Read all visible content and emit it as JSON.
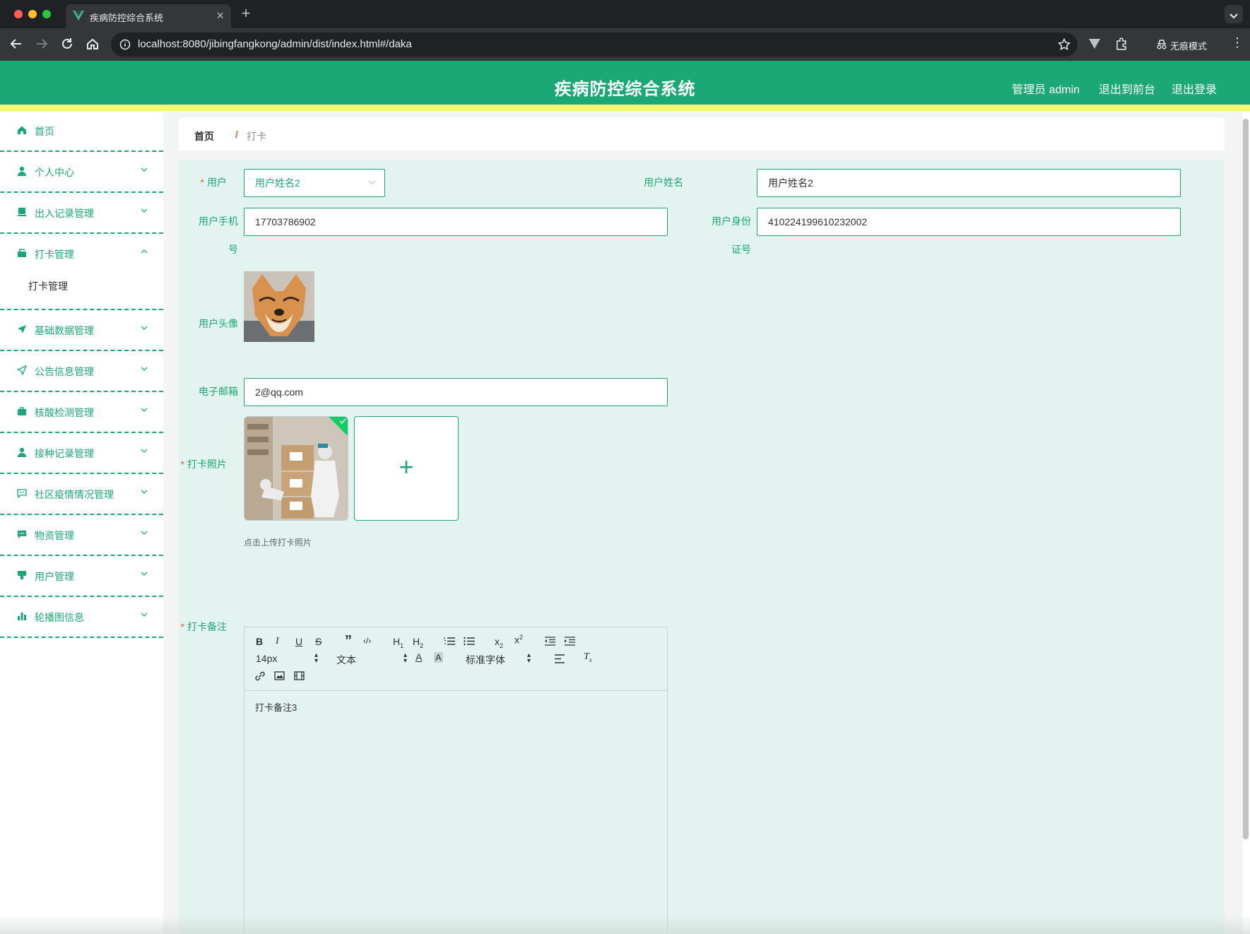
{
  "browser": {
    "tab_title": "疾病防控综合系统",
    "url": "localhost:8080/jibingfangkong/admin/dist/index.html#/daka",
    "incognito_label": "无痕模式"
  },
  "header": {
    "title": "疾病防控综合系统",
    "user_label": "管理员 admin",
    "to_front": "退出到前台",
    "logout": "退出登录"
  },
  "sidebar": {
    "items": [
      {
        "label": "首页",
        "icon": "home-icon"
      },
      {
        "label": "个人中心",
        "icon": "user-icon"
      },
      {
        "label": "出入记录管理",
        "icon": "record-icon"
      },
      {
        "label": "打卡管理",
        "icon": "punch-icon",
        "expanded": true
      },
      {
        "label": "基础数据管理",
        "icon": "send-icon"
      },
      {
        "label": "公告信息管理",
        "icon": "notice-icon"
      },
      {
        "label": "核酸检测管理",
        "icon": "briefcase-icon"
      },
      {
        "label": "接种记录管理",
        "icon": "user-icon"
      },
      {
        "label": "社区疫情情况管理",
        "icon": "chat-icon"
      },
      {
        "label": "物资管理",
        "icon": "message-icon"
      },
      {
        "label": "用户管理",
        "icon": "stamp-icon"
      },
      {
        "label": "轮播图信息",
        "icon": "chart-icon"
      }
    ],
    "submenu_label": "打卡管理"
  },
  "breadcrumb": {
    "home": "首页",
    "separator": "/",
    "current": "打卡"
  },
  "form": {
    "user_label": "用户",
    "user_value": "用户姓名2",
    "username_label": "用户姓名",
    "username_value": "用户姓名2",
    "phone_label_1": "用户手机",
    "phone_label_2": "号",
    "phone_value": "17703786902",
    "idcard_label_1": "用户身份",
    "idcard_label_2": "证号",
    "idcard_value": "410224199610232002",
    "avatar_label": "用户头像",
    "email_label": "电子邮箱",
    "email_value": "2@qq.com",
    "photo_label": "打卡照片",
    "photo_tip": "点击上传打卡照片",
    "upload_plus": "+",
    "remark_label": "打卡备注",
    "required_mark": "*"
  },
  "editor": {
    "font_size": "14px",
    "text_type": "文本",
    "font_family": "标准字体",
    "content": "打卡备注3"
  },
  "colors": {
    "primary": "#1ba876",
    "accent_strip": "#f3fa6e",
    "panel": "#e3f4f0",
    "required": "#e6583a"
  }
}
